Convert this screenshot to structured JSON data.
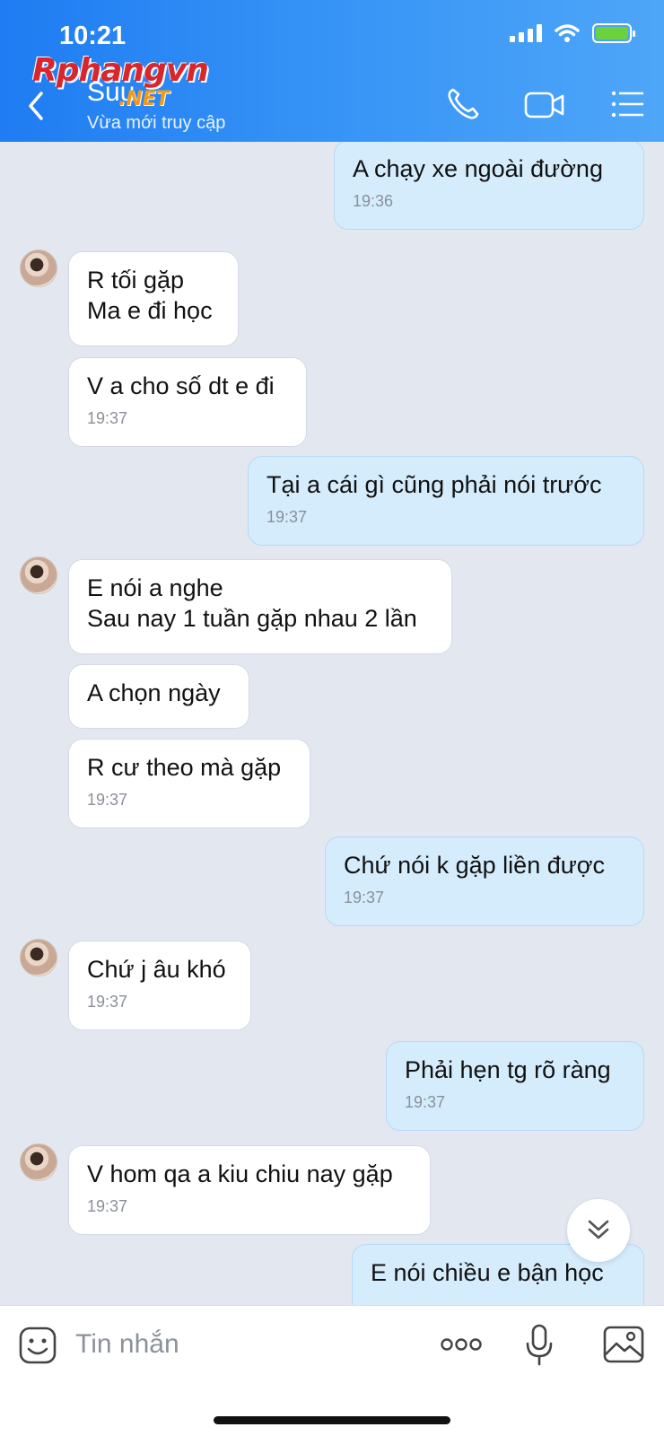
{
  "status_bar": {
    "time": "10:21"
  },
  "watermark": {
    "main": "Rphangvn",
    "sub": ".NET"
  },
  "header": {
    "name": "Suu",
    "status": "Vừa mới truy cập"
  },
  "messages": [
    {
      "dir": "out",
      "text": "A chạy xe ngoài đường",
      "time": "19:36"
    },
    {
      "dir": "in",
      "text": "R tối gặp\nMa e đi học"
    },
    {
      "dir": "in",
      "text": "V a cho số dt e đi",
      "time": "19:37"
    },
    {
      "dir": "out",
      "text": "Tại a cái gì cũng phải nói trước",
      "time": "19:37"
    },
    {
      "dir": "in",
      "text": "E nói a nghe\nSau nay 1 tuần gặp nhau 2 lần"
    },
    {
      "dir": "in",
      "text": "A chọn ngày"
    },
    {
      "dir": "in",
      "text": "R cư theo mà gặp",
      "time": "19:37"
    },
    {
      "dir": "out",
      "text": "Chứ nói k gặp liền được",
      "time": "19:37"
    },
    {
      "dir": "in",
      "text": "Chứ j âu khó",
      "time": "19:37"
    },
    {
      "dir": "out",
      "text": "Phải hẹn tg rõ ràng",
      "time": "19:37"
    },
    {
      "dir": "in",
      "text": "V hom qa a kiu chiu nay gặp",
      "time": "19:37"
    },
    {
      "dir": "out",
      "text": "E nói chiều e bận học"
    }
  ],
  "input": {
    "placeholder": "Tin nhắn"
  },
  "icons": {
    "back": "chevron-left-icon",
    "call": "phone-icon",
    "video": "video-camera-icon",
    "menu": "list-menu-icon",
    "emoji": "emoji-icon",
    "more": "more-dots-icon",
    "mic": "microphone-icon",
    "image": "image-icon",
    "scroll": "double-chevron-down-icon"
  },
  "colors": {
    "header": "#3996f6",
    "outgoing": "#d5ecfd",
    "incoming": "#ffffff",
    "background": "#e3e8f0"
  }
}
